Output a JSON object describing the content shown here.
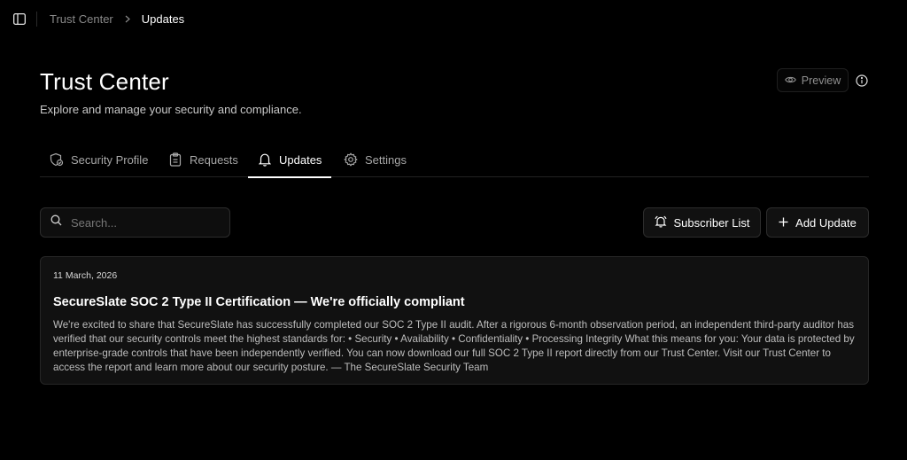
{
  "breadcrumb": {
    "parent": "Trust Center",
    "current": "Updates"
  },
  "header": {
    "title": "Trust Center",
    "subtitle": "Explore and manage your security and compliance.",
    "preview_label": "Preview"
  },
  "tabs": [
    {
      "label": "Security Profile",
      "icon": "shield-check-icon",
      "active": false
    },
    {
      "label": "Requests",
      "icon": "clipboard-icon",
      "active": false
    },
    {
      "label": "Updates",
      "icon": "bell-icon",
      "active": true
    },
    {
      "label": "Settings",
      "icon": "gear-icon",
      "active": false
    }
  ],
  "toolbar": {
    "search_placeholder": "Search...",
    "subscriber_label": "Subscriber List",
    "add_label": "Add Update"
  },
  "updates": [
    {
      "date": "11 March, 2026",
      "title": "SecureSlate SOC 2 Type II Certification — We're officially compliant",
      "body": "We're excited to share that SecureSlate has successfully completed our SOC 2 Type II audit. After a rigorous 6-month observation period, an independent third-party auditor has verified that our security controls meet the highest standards for: • Security • Availability • Confidentiality • Processing Integrity What this means for you: Your data is protected by enterprise-grade controls that have been independently verified. You can now download our full SOC 2 Type II report directly from our Trust Center. Visit our Trust Center to access the report and learn more about our security posture. — The SecureSlate Security Team"
    }
  ],
  "colors": {
    "background": "#000000",
    "card": "#111111",
    "border": "#262626",
    "muted_text": "#8a8a8a"
  }
}
